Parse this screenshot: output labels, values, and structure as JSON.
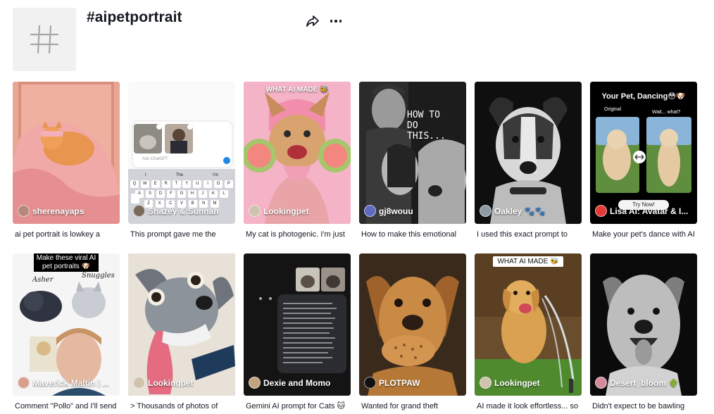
{
  "header": {
    "title": "#aipetportrait",
    "icons": {
      "tag": "hashtag-icon",
      "share": "share-icon",
      "more": "more-icon"
    }
  },
  "colors": {
    "text": "#161823",
    "placeholder_bg": "#f1f1f2",
    "accent": "#fe2c55"
  },
  "videos": [
    {
      "author": "sherenayaps",
      "caption": "ai pet portrait is lowkey a"
    },
    {
      "author": "Shazey & Sunnah",
      "caption": "This prompt gave me the"
    },
    {
      "author": "Lookingpet",
      "caption": "My cat is photogenic. I'm just",
      "overlay": "WHAT AI MADE 🐝"
    },
    {
      "author": "gj8wouu",
      "caption": "How to make this emotional",
      "overlay": "HOW TO DO THIS..."
    },
    {
      "author": "Oakley 🐾🐾",
      "caption": "I used this exact prompt to"
    },
    {
      "author": "Lisa AI: Avatar & I...",
      "caption": "Make your pet's dance with AI",
      "overlay": "Your Pet, Dancing😳🐶",
      "sub_left": "Original",
      "sub_right": "Wait... what?",
      "button": "Try Now!"
    },
    {
      "author": "Maverick Maltin | ...",
      "caption": "Comment \"Pollo\" and I'll send",
      "overlay": "Make these viral AI pet portraits 🐶",
      "sub_left": "Asher",
      "sub_right": "Snuggles"
    },
    {
      "author": "Lookingpet",
      "caption": "> Thousands of photos of"
    },
    {
      "author": "Dexie and Momo",
      "caption": "Gemini AI prompt for Cats 🐱"
    },
    {
      "author": "PLOTPAW",
      "caption": "Wanted for grand theft"
    },
    {
      "author": "Lookingpet",
      "caption": "AI made it look effortless... so",
      "overlay": "WHAT AI MADE 🐝"
    },
    {
      "author": "Desert_bloom 🌵",
      "caption": "Didn't expect to be bawling"
    }
  ],
  "chat_mock": {
    "placeholder": "Ask ChatGPT",
    "suggestions": [
      "I",
      "The",
      "I'm"
    ],
    "keys_row1": [
      "Q",
      "W",
      "E",
      "R",
      "T",
      "Y",
      "U",
      "I",
      "O",
      "P"
    ],
    "keys_row2": [
      "A",
      "S",
      "D",
      "F",
      "G",
      "H",
      "J",
      "K",
      "L"
    ],
    "keys_row3": [
      "Z",
      "X",
      "C",
      "V",
      "B",
      "N",
      "M"
    ]
  }
}
